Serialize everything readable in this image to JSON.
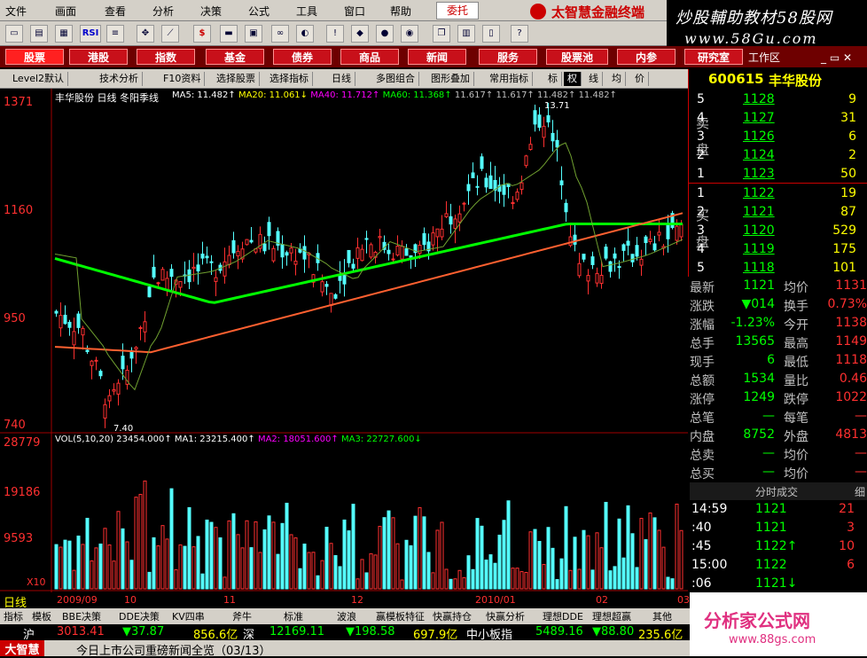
{
  "menu": [
    "文件",
    "画面",
    "查看",
    "分析",
    "决策",
    "公式",
    "工具",
    "窗口",
    "帮助"
  ],
  "delegate": "委托",
  "brand": "太智慧金融终端",
  "watermark": {
    "line1": "炒股輔助教材58股网",
    "line2": "www.58Gu.com"
  },
  "nav": [
    "股票",
    "港股",
    "指数",
    "基金",
    "债券",
    "商品",
    "新闻",
    "服务",
    "股票池",
    "内参",
    "研究室"
  ],
  "workarea": "工作区",
  "subbar": [
    "Level2默认",
    "技术分析",
    "F10资料",
    "选择股票",
    "选择指标",
    "日线",
    "多图组合",
    "图形叠加",
    "常用指标",
    "标",
    "权",
    "线",
    "均",
    "价"
  ],
  "stock": {
    "code": "600615",
    "name": "丰华股份"
  },
  "chart_title": "丰华股份 日线 冬阳季线",
  "ma_line": {
    "ma5": "MA5: 11.482↑",
    "ma20": "MA20: 11.061↓",
    "ma40": "MA40: 11.712↑",
    "ma60": "MA60: 11.368↑",
    "v1": "11.617↑",
    "v2": "11.617↑",
    "v3": "11.482↑",
    "v4": "11.482↑"
  },
  "vol_line": {
    "vol": "VOL(5,10,20) 23454.000↑",
    "ma1": "MA1: 23215.400↑",
    "ma2": "MA2: 18051.600↑",
    "ma3": "MA3: 22727.600↓"
  },
  "price_axis": [
    "1371",
    "1160",
    "950",
    "740"
  ],
  "vol_axis": [
    "28779",
    "19186",
    "9593",
    "X10"
  ],
  "annot_high": "13.71",
  "annot_low": "7.40",
  "date_axis": [
    "2009/09",
    "10",
    "11",
    "12",
    "2010/01",
    "02",
    "03"
  ],
  "sell": [
    {
      "n": "5",
      "p": "1128",
      "v": "9"
    },
    {
      "n": "4",
      "p": "1127",
      "v": "31"
    },
    {
      "n": "3",
      "p": "1126",
      "v": "6"
    },
    {
      "n": "2",
      "p": "1124",
      "v": "2"
    },
    {
      "n": "1",
      "p": "1123",
      "v": "50"
    }
  ],
  "sell_label": [
    "卖",
    "盘"
  ],
  "buy": [
    {
      "n": "1",
      "p": "1122",
      "v": "19"
    },
    {
      "n": "2",
      "p": "1121",
      "v": "87"
    },
    {
      "n": "3",
      "p": "1120",
      "v": "529"
    },
    {
      "n": "4",
      "p": "1119",
      "v": "175"
    },
    {
      "n": "5",
      "p": "1118",
      "v": "101"
    }
  ],
  "buy_label": [
    "买",
    "盘"
  ],
  "stats": [
    {
      "l1": "最新",
      "v1": "1121",
      "l2": "均价",
      "v2": "1131"
    },
    {
      "l1": "涨跌",
      "v1": "▼014",
      "l2": "换手",
      "v2": "0.73%"
    },
    {
      "l1": "涨幅",
      "v1": "-1.23%",
      "l2": "今开",
      "v2": "1138"
    },
    {
      "l1": "总手",
      "v1": "13565",
      "l2": "最高",
      "v2": "1149"
    },
    {
      "l1": "现手",
      "v1": "6",
      "l2": "最低",
      "v2": "1118"
    },
    {
      "l1": "总额",
      "v1": "1534",
      "l2": "量比",
      "v2": "0.46"
    },
    {
      "l1": "涨停",
      "v1": "1249",
      "l2": "跌停",
      "v2": "1022"
    },
    {
      "l1": "总笔",
      "v1": "—",
      "l2": "每笔",
      "v2": "—"
    },
    {
      "l1": "内盘",
      "v1": "8752",
      "l2": "外盘",
      "v2": "4813"
    },
    {
      "l1": "总卖",
      "v1": "—",
      "l2": "均价",
      "v2": "—"
    },
    {
      "l1": "总买",
      "v1": "—",
      "l2": "均价",
      "v2": "—"
    }
  ],
  "ticks_header": "分时成交",
  "ticks_side": "细",
  "ticks": [
    {
      "t": "14:59",
      "p": "1121",
      "v": "21"
    },
    {
      "t": ":40",
      "p": "1121",
      "v": "3"
    },
    {
      "t": ":45",
      "p": "1122↑",
      "v": "10"
    },
    {
      "t": "15:00",
      "p": "1122",
      "v": "6"
    },
    {
      "t": ":06",
      "p": "1121↓",
      "v": ""
    }
  ],
  "period_label": "日线",
  "tabs": [
    "指标",
    "模板",
    "BBE决策",
    "DDE决策",
    "KV四串",
    "斧牛",
    "标准",
    "波浪",
    "赢模板特征",
    "快赢持仓",
    "快赢分析",
    "理想DDE",
    "理想超赢",
    "其他"
  ],
  "ticker": {
    "sh": "沪",
    "sh_idx": "3013.41",
    "sh_chg": "▼37.87",
    "sh_amt": "856.6亿",
    "sz": "深",
    "sz_idx": "12169.11",
    "sz_chg": "▼198.58",
    "sz_amt": "697.9亿",
    "zx": "中小板指",
    "zx_idx": "5489.16",
    "zx_chg": "▼88.80",
    "zx_amt": "235.6亿"
  },
  "news": {
    "brand": "大智慧",
    "text": "今日上市公司重磅新闻全览（03/13）"
  },
  "logo2": {
    "line1": "分析家公式网",
    "line2": "www.88gs.com"
  },
  "colors": {
    "ma5": "#ffffff",
    "ma20": "#ffff00",
    "ma40": "#ff00ff",
    "ma60": "#00ff00",
    "up": "#ff3030",
    "down": "#54ffff"
  },
  "chart_data": {
    "type": "candlestick",
    "x": [
      "2009/09",
      "10",
      "11",
      "12",
      "2010/01",
      "02",
      "03"
    ],
    "ylim": [
      7.4,
      13.71
    ],
    "high": 13.71,
    "low": 7.4
  }
}
